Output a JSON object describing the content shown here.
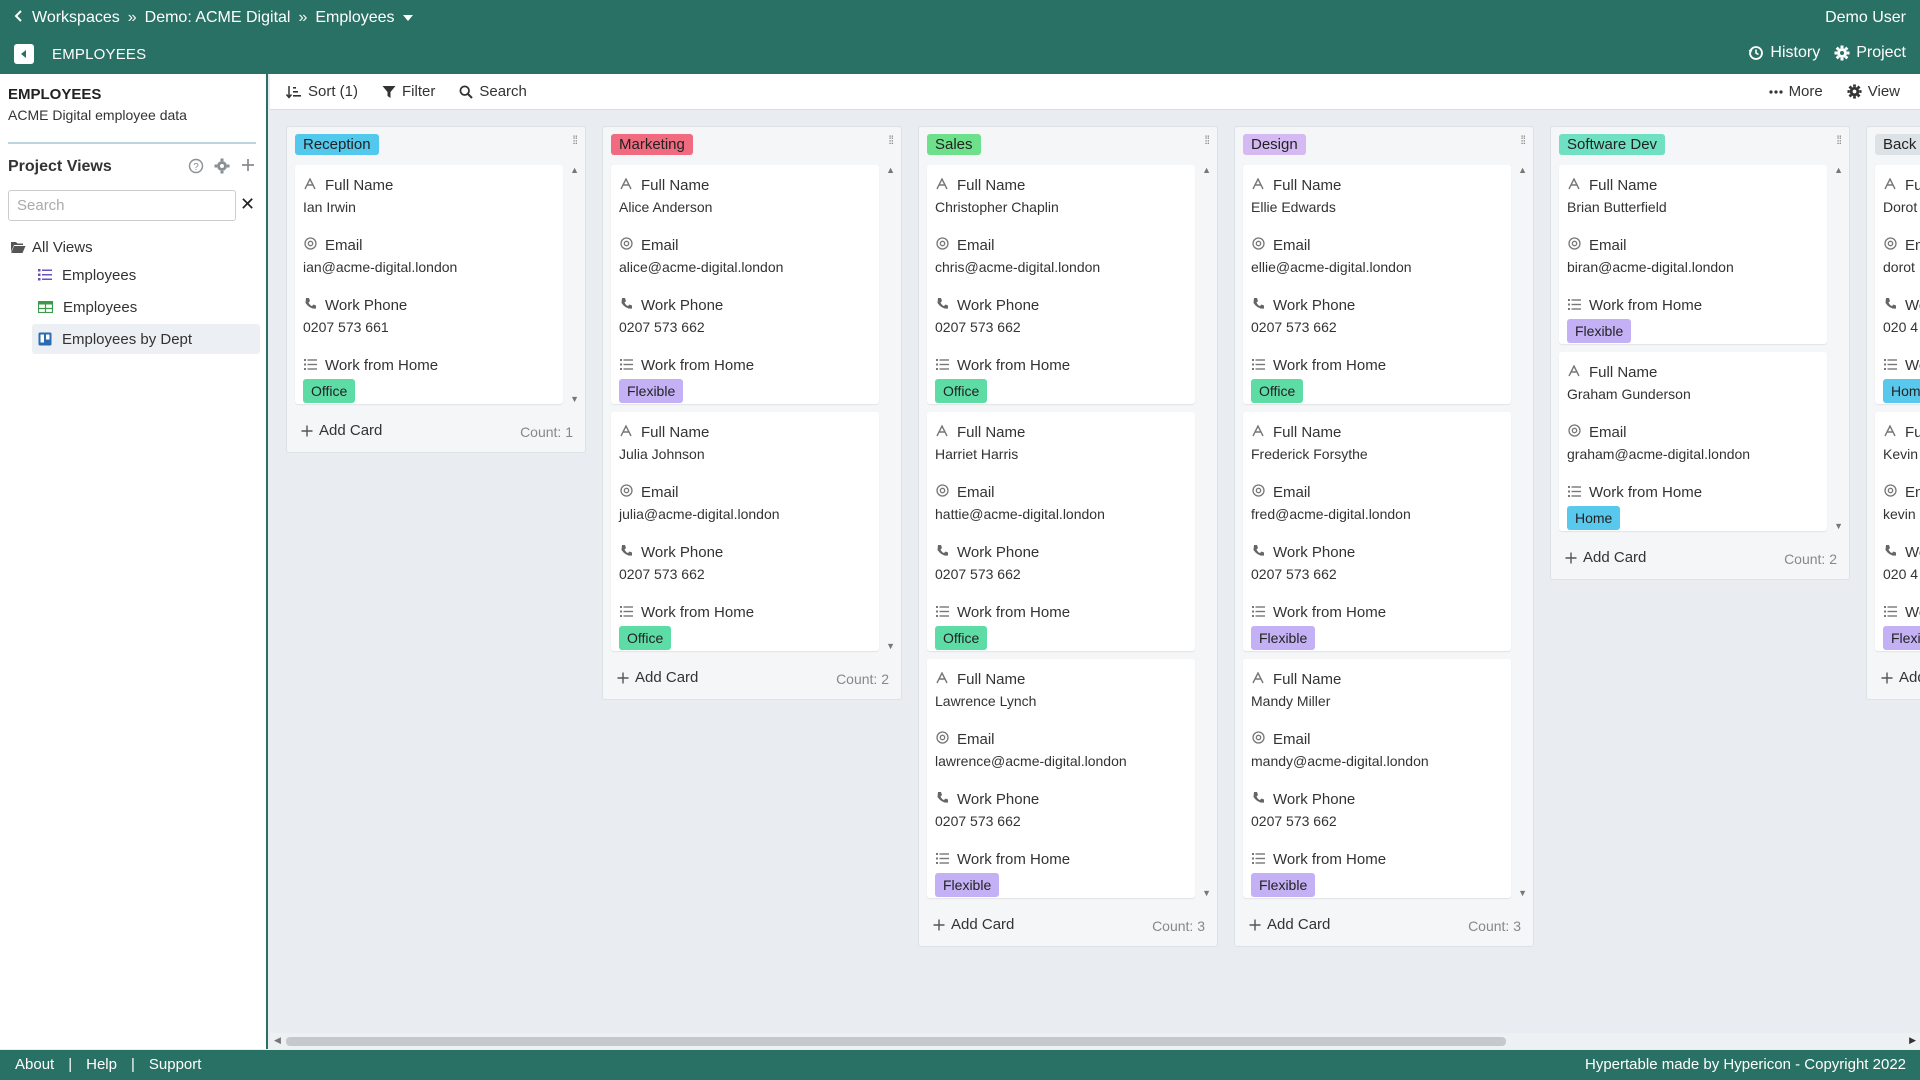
{
  "topbar": {
    "breadcrumbs": [
      "Workspaces",
      "Demo: ACME Digital",
      "Employees"
    ],
    "user": "Demo User",
    "section_title": "EMPLOYEES",
    "history": "History",
    "project": "Project"
  },
  "sidebar": {
    "title": "EMPLOYEES",
    "subtitle": "ACME Digital employee data",
    "project_views_label": "Project Views",
    "search_placeholder": "Search",
    "all_views": "All Views",
    "views": [
      {
        "label": "Employees",
        "icon": "list-icon"
      },
      {
        "label": "Employees",
        "icon": "grid-icon"
      },
      {
        "label": "Employees by Dept",
        "icon": "kanban-icon"
      }
    ]
  },
  "toolbar": {
    "sort": "Sort (1)",
    "filter": "Filter",
    "search": "Search",
    "more": "More",
    "view": "View"
  },
  "labels": {
    "full_name": "Full Name",
    "email": "Email",
    "work_phone": "Work Phone",
    "work_from_home": "Work from Home",
    "add_card": "Add Card"
  },
  "colors": {
    "brand": "#2a7165",
    "Office": "#5ddca6",
    "Flexible": "#c4b1f5",
    "Home": "#58c9ec"
  },
  "columns": [
    {
      "name": "Reception",
      "color": "#52c8ec",
      "count": "Count: 1",
      "cards": [
        {
          "name": "Ian Irwin",
          "email": "ian@acme-digital.london",
          "phone": "0207 573 661",
          "wfh": "Office"
        }
      ]
    },
    {
      "name": "Marketing",
      "color": "#f06b80",
      "count": "Count: 2",
      "cards": [
        {
          "name": "Alice Anderson",
          "email": "alice@acme-digital.london",
          "phone": "0207 573 662",
          "wfh": "Flexible"
        },
        {
          "name": "Julia Johnson",
          "email": "julia@acme-digital.london",
          "phone": "0207 573 662",
          "wfh": "Office"
        }
      ]
    },
    {
      "name": "Sales",
      "color": "#6ee08c",
      "count": "Count: 3",
      "cards": [
        {
          "name": "Christopher Chaplin",
          "email": "chris@acme-digital.london",
          "phone": "0207 573 662",
          "wfh": "Office"
        },
        {
          "name": "Harriet Harris",
          "email": "hattie@acme-digital.london",
          "phone": "0207 573 662",
          "wfh": "Office"
        },
        {
          "name": "Lawrence Lynch",
          "email": "lawrence@acme-digital.london",
          "phone": "0207 573 662",
          "wfh": "Flexible"
        }
      ]
    },
    {
      "name": "Design",
      "color": "#d4b9f3",
      "count": "Count: 3",
      "cards": [
        {
          "name": "Ellie Edwards",
          "email": "ellie@acme-digital.london",
          "phone": "0207 573 662",
          "wfh": "Office"
        },
        {
          "name": "Frederick Forsythe",
          "email": "fred@acme-digital.london",
          "phone": "0207 573 662",
          "wfh": "Flexible"
        },
        {
          "name": "Mandy Miller",
          "email": "mandy@acme-digital.london",
          "phone": "0207 573 662",
          "wfh": "Flexible"
        }
      ]
    },
    {
      "name": "Software Dev",
      "color": "#6fe0c2",
      "count": "Count: 2",
      "cards": [
        {
          "name": "Brian Butterfield",
          "email": "biran@acme-digital.london",
          "wfh": "Flexible"
        },
        {
          "name": "Graham Gunderson",
          "email": "graham@acme-digital.london",
          "wfh": "Home"
        }
      ]
    },
    {
      "name": "Back",
      "color": "#dde2e7",
      "count": "",
      "cards": [
        {
          "name": "Dorot",
          "email": "dorot",
          "phone": "020 4",
          "wfh": "Hom"
        },
        {
          "name": "Kevin",
          "email": "kevin",
          "phone": "020 4",
          "wfh": "Flexi"
        }
      ]
    }
  ],
  "footer": {
    "links": [
      "About",
      "Help",
      "Support"
    ],
    "copyright": "Hypertable made by Hypericon - Copyright 2022"
  }
}
